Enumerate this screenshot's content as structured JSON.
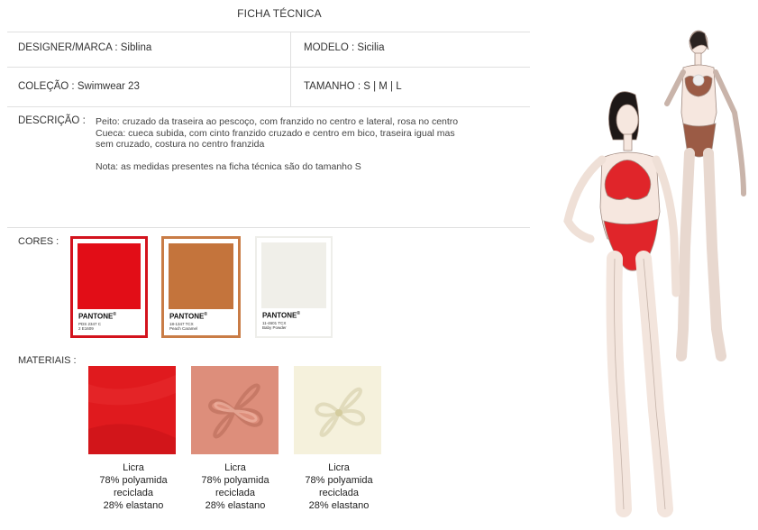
{
  "title": "FICHA TÉCNICA",
  "row1": {
    "left": "DESIGNER/MARCA : Siblina",
    "right": "MODELO : Sicilia"
  },
  "row2": {
    "left": "COLEÇÃO : Swimwear 23",
    "right": "TAMANHO : S | M | L"
  },
  "description": {
    "label": "DESCRIÇÃO :",
    "line1": "Peito: cruzado da traseira ao pescoço, com franzido no centro e lateral, rosa no centro",
    "line2": "Cueca: cueca subida, com cinto franzido cruzado e centro em bico, traseira igual mas",
    "line3": "sem cruzado, costura no centro franzida",
    "note": "Nota: as medidas presentes na ficha técnica são do tamanho S"
  },
  "colors": {
    "label": "CORES :",
    "swatches": [
      {
        "brand": "PANTONE",
        "code": "PDS 2347 C",
        "name": "2 E1609",
        "color": "#e20d17",
        "border": "#d3131d"
      },
      {
        "brand": "PANTONE",
        "code": "18-1347 TCX",
        "name": "Peach Caramel",
        "color": "#c4743c",
        "border": "#c97c46"
      },
      {
        "brand": "PANTONE",
        "code": "11-4601 TCX",
        "name": "Baby Powder",
        "color": "#f0efe9",
        "border": "#eeeeea"
      }
    ]
  },
  "materials": {
    "label": "MATERIAIS :",
    "items": [
      {
        "line1": "Licra",
        "line2": "78% polyamida",
        "line3": "reciclada",
        "line4": "28% elastano",
        "color": "#e01a1e"
      },
      {
        "line1": "Licra",
        "line2": "78% polyamida",
        "line3": "reciclada",
        "line4": "28% elastano",
        "color": "#dd8e7b"
      },
      {
        "line1": "Licra",
        "line2": "78% polyamida",
        "line3": "reciclada",
        "line4": "28% elastano",
        "color": "#f5f1dc"
      }
    ]
  },
  "illustration": {
    "front_color": "#e0252a",
    "back_color": "#9b5b45",
    "skin": "#f6e7df"
  }
}
